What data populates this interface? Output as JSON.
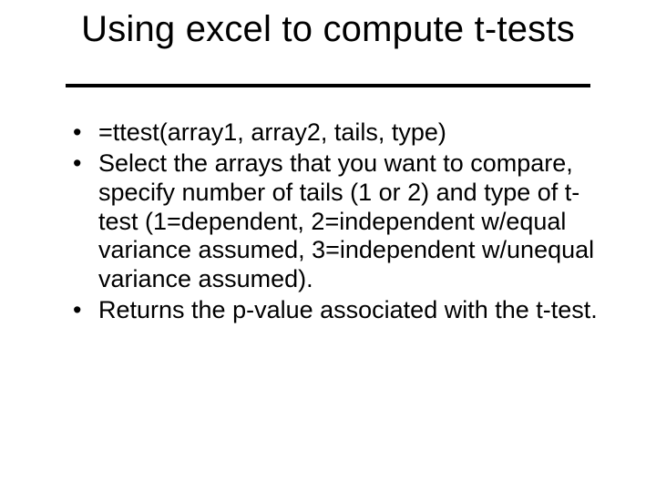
{
  "slide": {
    "title": "Using excel to compute t-tests",
    "bullets": [
      "=ttest(array1, array2, tails, type)",
      "Select the arrays that you want to compare, specify number of tails (1 or 2) and type of t-test (1=dependent, 2=independent w/equal variance assumed, 3=independent w/unequal variance assumed).",
      "Returns the p-value associated with the t-test."
    ]
  }
}
